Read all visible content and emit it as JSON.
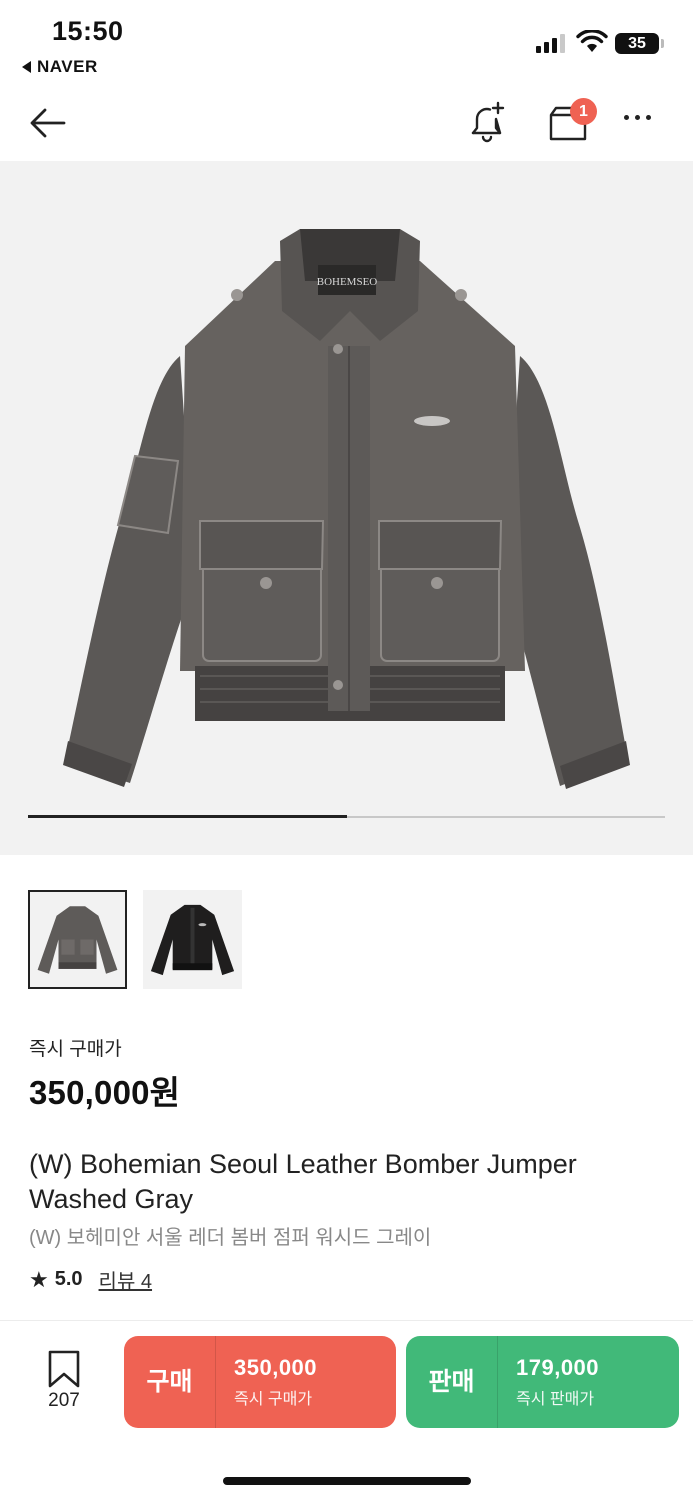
{
  "status_bar": {
    "time": "15:50",
    "back_app": "NAVER",
    "battery": "35"
  },
  "nav": {
    "cart_badge": "1"
  },
  "gallery": {
    "progress_fraction": 0.5,
    "jacket_label": "BOHEMSEO"
  },
  "thumbnails": [
    {
      "color": "washed gray",
      "selected": true
    },
    {
      "color": "black",
      "selected": false
    }
  ],
  "price": {
    "label": "즉시 구매가",
    "value": "350,000원"
  },
  "product": {
    "title_en": "(W) Bohemian Seoul Leather Bomber Jumper Washed Gray",
    "title_ko": "(W) 보헤미안 서울 레더 봄버 점퍼 워시드 그레이",
    "rating_star": "★",
    "rating": "5.0",
    "reviews": "리뷰 4"
  },
  "bottom_bar": {
    "bookmark_count": "207",
    "buy": {
      "label": "구매",
      "amount": "350,000",
      "sub": "즉시 구매가"
    },
    "sell": {
      "label": "판매",
      "amount": "179,000",
      "sub": "즉시 판매가"
    }
  },
  "colors": {
    "buy": "#ef6253",
    "sell": "#41b979",
    "badge": "#ef6253"
  }
}
